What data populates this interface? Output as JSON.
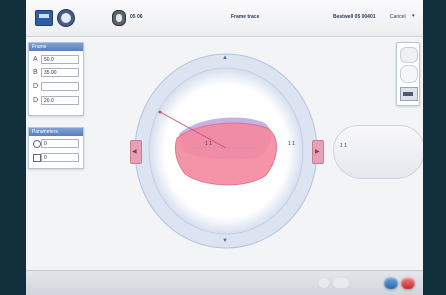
{
  "header": {
    "code": "05 06",
    "title": "Frame trace",
    "info": "Bestwell 05 00401",
    "action": "Cancel"
  },
  "panels": {
    "frame": {
      "title": "Frame",
      "fields": [
        {
          "icon": "A",
          "value": "50.0"
        },
        {
          "icon": "B",
          "value": "35.00"
        },
        {
          "icon": "D",
          "value": ""
        },
        {
          "icon": "D",
          "value": "20.0"
        }
      ]
    },
    "params": {
      "title": "Parameters",
      "fields": [
        {
          "icon": "",
          "value": "0"
        },
        {
          "icon": "",
          "value": "0"
        }
      ]
    }
  },
  "marks": {
    "left_a": "1 1",
    "left_b": "1 1",
    "right_a": "1 1"
  },
  "colors": {
    "accent": "#6f8fcc",
    "lens": "#f07ca0",
    "ring": "#d9e2f1"
  },
  "icons": [
    "scanner-icon",
    "tracer-icon",
    "lens-icon",
    "arrow-up-icon",
    "arrow-down-icon",
    "arrow-left-icon",
    "arrow-right-icon",
    "confirm-icon",
    "cancel-icon"
  ]
}
